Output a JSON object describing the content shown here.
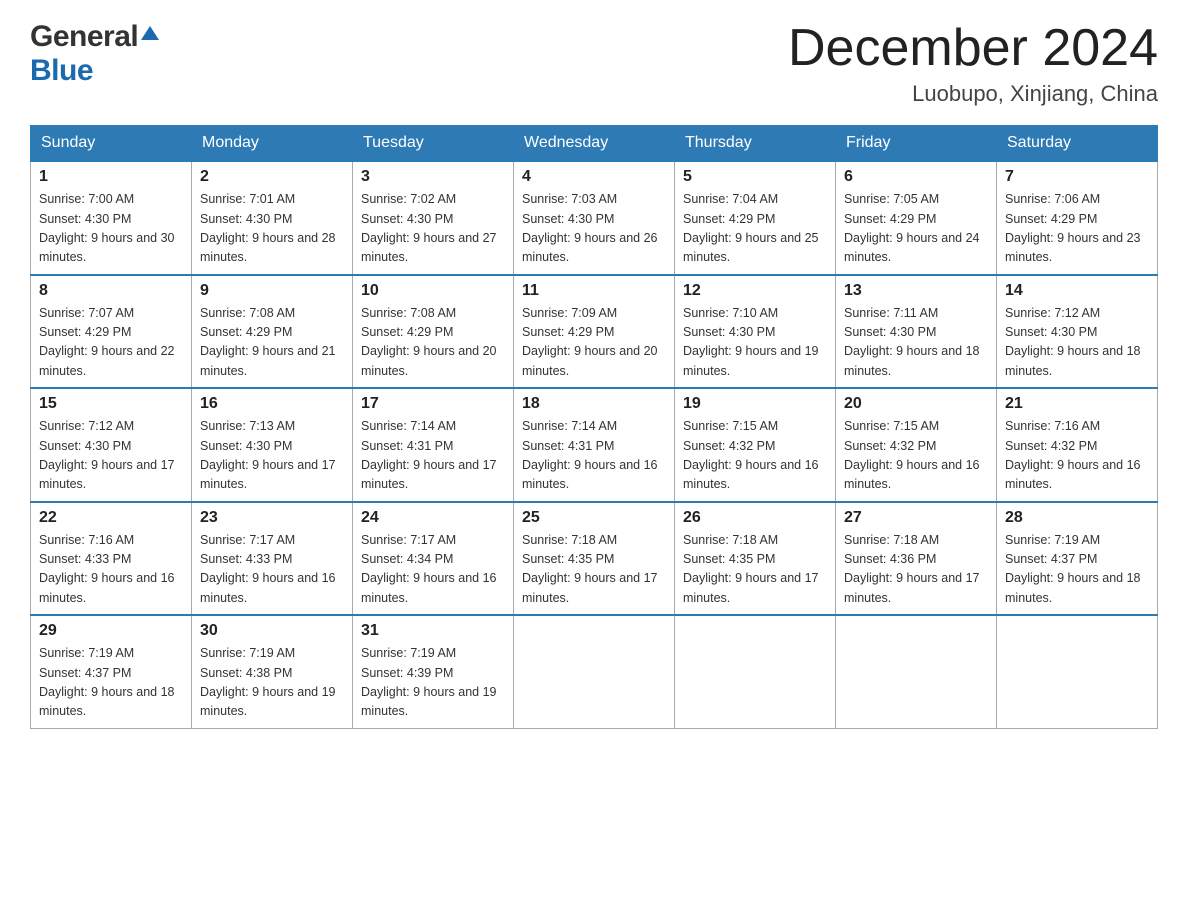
{
  "header": {
    "logo_general": "General",
    "logo_blue": "Blue",
    "month_title": "December 2024",
    "location": "Luobupo, Xinjiang, China"
  },
  "weekdays": [
    "Sunday",
    "Monday",
    "Tuesday",
    "Wednesday",
    "Thursday",
    "Friday",
    "Saturday"
  ],
  "weeks": [
    [
      {
        "day": "1",
        "sunrise": "Sunrise: 7:00 AM",
        "sunset": "Sunset: 4:30 PM",
        "daylight": "Daylight: 9 hours and 30 minutes."
      },
      {
        "day": "2",
        "sunrise": "Sunrise: 7:01 AM",
        "sunset": "Sunset: 4:30 PM",
        "daylight": "Daylight: 9 hours and 28 minutes."
      },
      {
        "day": "3",
        "sunrise": "Sunrise: 7:02 AM",
        "sunset": "Sunset: 4:30 PM",
        "daylight": "Daylight: 9 hours and 27 minutes."
      },
      {
        "day": "4",
        "sunrise": "Sunrise: 7:03 AM",
        "sunset": "Sunset: 4:30 PM",
        "daylight": "Daylight: 9 hours and 26 minutes."
      },
      {
        "day": "5",
        "sunrise": "Sunrise: 7:04 AM",
        "sunset": "Sunset: 4:29 PM",
        "daylight": "Daylight: 9 hours and 25 minutes."
      },
      {
        "day": "6",
        "sunrise": "Sunrise: 7:05 AM",
        "sunset": "Sunset: 4:29 PM",
        "daylight": "Daylight: 9 hours and 24 minutes."
      },
      {
        "day": "7",
        "sunrise": "Sunrise: 7:06 AM",
        "sunset": "Sunset: 4:29 PM",
        "daylight": "Daylight: 9 hours and 23 minutes."
      }
    ],
    [
      {
        "day": "8",
        "sunrise": "Sunrise: 7:07 AM",
        "sunset": "Sunset: 4:29 PM",
        "daylight": "Daylight: 9 hours and 22 minutes."
      },
      {
        "day": "9",
        "sunrise": "Sunrise: 7:08 AM",
        "sunset": "Sunset: 4:29 PM",
        "daylight": "Daylight: 9 hours and 21 minutes."
      },
      {
        "day": "10",
        "sunrise": "Sunrise: 7:08 AM",
        "sunset": "Sunset: 4:29 PM",
        "daylight": "Daylight: 9 hours and 20 minutes."
      },
      {
        "day": "11",
        "sunrise": "Sunrise: 7:09 AM",
        "sunset": "Sunset: 4:29 PM",
        "daylight": "Daylight: 9 hours and 20 minutes."
      },
      {
        "day": "12",
        "sunrise": "Sunrise: 7:10 AM",
        "sunset": "Sunset: 4:30 PM",
        "daylight": "Daylight: 9 hours and 19 minutes."
      },
      {
        "day": "13",
        "sunrise": "Sunrise: 7:11 AM",
        "sunset": "Sunset: 4:30 PM",
        "daylight": "Daylight: 9 hours and 18 minutes."
      },
      {
        "day": "14",
        "sunrise": "Sunrise: 7:12 AM",
        "sunset": "Sunset: 4:30 PM",
        "daylight": "Daylight: 9 hours and 18 minutes."
      }
    ],
    [
      {
        "day": "15",
        "sunrise": "Sunrise: 7:12 AM",
        "sunset": "Sunset: 4:30 PM",
        "daylight": "Daylight: 9 hours and 17 minutes."
      },
      {
        "day": "16",
        "sunrise": "Sunrise: 7:13 AM",
        "sunset": "Sunset: 4:30 PM",
        "daylight": "Daylight: 9 hours and 17 minutes."
      },
      {
        "day": "17",
        "sunrise": "Sunrise: 7:14 AM",
        "sunset": "Sunset: 4:31 PM",
        "daylight": "Daylight: 9 hours and 17 minutes."
      },
      {
        "day": "18",
        "sunrise": "Sunrise: 7:14 AM",
        "sunset": "Sunset: 4:31 PM",
        "daylight": "Daylight: 9 hours and 16 minutes."
      },
      {
        "day": "19",
        "sunrise": "Sunrise: 7:15 AM",
        "sunset": "Sunset: 4:32 PM",
        "daylight": "Daylight: 9 hours and 16 minutes."
      },
      {
        "day": "20",
        "sunrise": "Sunrise: 7:15 AM",
        "sunset": "Sunset: 4:32 PM",
        "daylight": "Daylight: 9 hours and 16 minutes."
      },
      {
        "day": "21",
        "sunrise": "Sunrise: 7:16 AM",
        "sunset": "Sunset: 4:32 PM",
        "daylight": "Daylight: 9 hours and 16 minutes."
      }
    ],
    [
      {
        "day": "22",
        "sunrise": "Sunrise: 7:16 AM",
        "sunset": "Sunset: 4:33 PM",
        "daylight": "Daylight: 9 hours and 16 minutes."
      },
      {
        "day": "23",
        "sunrise": "Sunrise: 7:17 AM",
        "sunset": "Sunset: 4:33 PM",
        "daylight": "Daylight: 9 hours and 16 minutes."
      },
      {
        "day": "24",
        "sunrise": "Sunrise: 7:17 AM",
        "sunset": "Sunset: 4:34 PM",
        "daylight": "Daylight: 9 hours and 16 minutes."
      },
      {
        "day": "25",
        "sunrise": "Sunrise: 7:18 AM",
        "sunset": "Sunset: 4:35 PM",
        "daylight": "Daylight: 9 hours and 17 minutes."
      },
      {
        "day": "26",
        "sunrise": "Sunrise: 7:18 AM",
        "sunset": "Sunset: 4:35 PM",
        "daylight": "Daylight: 9 hours and 17 minutes."
      },
      {
        "day": "27",
        "sunrise": "Sunrise: 7:18 AM",
        "sunset": "Sunset: 4:36 PM",
        "daylight": "Daylight: 9 hours and 17 minutes."
      },
      {
        "day": "28",
        "sunrise": "Sunrise: 7:19 AM",
        "sunset": "Sunset: 4:37 PM",
        "daylight": "Daylight: 9 hours and 18 minutes."
      }
    ],
    [
      {
        "day": "29",
        "sunrise": "Sunrise: 7:19 AM",
        "sunset": "Sunset: 4:37 PM",
        "daylight": "Daylight: 9 hours and 18 minutes."
      },
      {
        "day": "30",
        "sunrise": "Sunrise: 7:19 AM",
        "sunset": "Sunset: 4:38 PM",
        "daylight": "Daylight: 9 hours and 19 minutes."
      },
      {
        "day": "31",
        "sunrise": "Sunrise: 7:19 AM",
        "sunset": "Sunset: 4:39 PM",
        "daylight": "Daylight: 9 hours and 19 minutes."
      },
      null,
      null,
      null,
      null
    ]
  ]
}
